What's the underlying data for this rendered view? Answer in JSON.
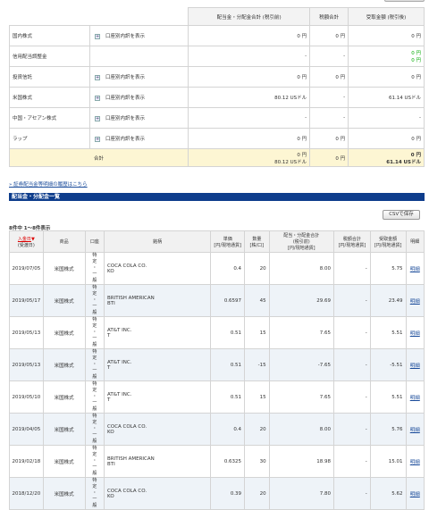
{
  "summary": {
    "headers": [
      "配当金・分配金合計 (税引前)",
      "税額合計",
      "受取金額 (税引後)"
    ],
    "rows": [
      {
        "label": "国内株式",
        "toggle": "口座別内訳を表示",
        "gross": [
          "0 円"
        ],
        "tax": [
          "0 円"
        ],
        "net": [
          "0 円"
        ]
      },
      {
        "label": "信用配当調整金",
        "toggle": "",
        "gross": [
          "-"
        ],
        "tax": [
          "-"
        ],
        "net": [
          "0 円",
          "0 円"
        ]
      },
      {
        "label": "投資信託",
        "toggle": "口座別内訳を表示",
        "gross": [
          "0 円"
        ],
        "tax": [
          "0 円"
        ],
        "net": [
          "0 円"
        ]
      },
      {
        "label": "米国株式",
        "toggle": "口座別内訳を表示",
        "gross": [
          "80.12 USドル"
        ],
        "tax": [
          "-"
        ],
        "net": [
          "61.14 USドル"
        ]
      },
      {
        "label": "中国・アセアン株式",
        "toggle": "口座別内訳を表示",
        "gross": [
          "-"
        ],
        "tax": [
          "-"
        ],
        "net": [
          "-"
        ]
      },
      {
        "label": "ラップ",
        "toggle": "口座別内訳を表示",
        "gross": [
          "0 円"
        ],
        "tax": [
          "0 円"
        ],
        "net": [
          "0 円"
        ]
      }
    ],
    "total": {
      "label": "合計",
      "gross": [
        "0 円",
        "80.12 USドル"
      ],
      "tax": [
        "0 円"
      ],
      "net": [
        "0 円",
        "61.14 USドル"
      ]
    }
  },
  "link_text": "» 証券配当金等明細の履歴はこちら",
  "section_title": "配当金・分配金一覧",
  "csv_button": "CSVで保存",
  "count_text": "8件中 1～8件表示",
  "table": {
    "headers": {
      "date": "入金日",
      "date_sub": "(受渡日)",
      "product": "商品",
      "account": "口座",
      "name": "銘柄",
      "unit": "単価",
      "unit_sub": "[円/現地通貨]",
      "qty": "数量",
      "qty_sub": "[株/口]",
      "gross": "配当・分配金合計",
      "gross_sub": "(税引前)",
      "gross_sub2": "[円/現地通貨]",
      "tax": "税額合計",
      "tax_sub": "[円/現地通貨]",
      "net": "受取金額",
      "net_sub": "[円/現地通貨]",
      "detail": "明細"
    },
    "rows": [
      {
        "date": "2019/07/05",
        "product": "米国株式",
        "account": [
          "特",
          "定",
          "・",
          "一",
          "般"
        ],
        "name1": "COCA COLA CO.",
        "name2": "KO",
        "unit": "0.4",
        "qty": "20",
        "gross": "8.00",
        "tax": "-",
        "net": "5.75",
        "detail": "明細"
      },
      {
        "date": "2019/05/17",
        "product": "米国株式",
        "account": [
          "特",
          "定",
          "・",
          "一",
          "般"
        ],
        "name1": "BRITISH AMERICAN",
        "name2": "BTI",
        "unit": "0.6597",
        "qty": "45",
        "gross": "29.69",
        "tax": "-",
        "net": "23.49",
        "detail": "明細"
      },
      {
        "date": "2019/05/13",
        "product": "米国株式",
        "account": [
          "特",
          "定",
          "・",
          "一",
          "般"
        ],
        "name1": "AT&T INC.",
        "name2": "T",
        "unit": "0.51",
        "qty": "15",
        "gross": "7.65",
        "tax": "-",
        "net": "5.51",
        "detail": "明細"
      },
      {
        "date": "2019/05/13",
        "product": "米国株式",
        "account": [
          "特",
          "定",
          "・",
          "一",
          "般"
        ],
        "name1": "AT&T INC.",
        "name2": "T",
        "unit": "0.51",
        "qty": "-15",
        "gross": "-7.65",
        "tax": "-",
        "net": "-5.51",
        "detail": "明細"
      },
      {
        "date": "2019/05/10",
        "product": "米国株式",
        "account": [
          "特",
          "定",
          "・",
          "一",
          "般"
        ],
        "name1": "AT&T INC.",
        "name2": "T",
        "unit": "0.51",
        "qty": "15",
        "gross": "7.65",
        "tax": "-",
        "net": "5.51",
        "detail": "明細"
      },
      {
        "date": "2019/04/05",
        "product": "米国株式",
        "account": [
          "特",
          "定",
          "・",
          "一",
          "般"
        ],
        "name1": "COCA COLA CO.",
        "name2": "KO",
        "unit": "0.4",
        "qty": "20",
        "gross": "8.00",
        "tax": "-",
        "net": "5.76",
        "detail": "明細"
      },
      {
        "date": "2019/02/18",
        "product": "米国株式",
        "account": [
          "特",
          "定",
          "・",
          "一",
          "般"
        ],
        "name1": "BRITISH AMERICAN",
        "name2": "BTI",
        "unit": "0.6325",
        "qty": "30",
        "gross": "18.98",
        "tax": "-",
        "net": "15.01",
        "detail": "明細"
      },
      {
        "date": "2018/12/20",
        "product": "米国株式",
        "account": [
          "特",
          "定",
          "・",
          "一",
          "般"
        ],
        "name1": "COCA COLA CO.",
        "name2": "KO",
        "unit": "0.39",
        "gross": "7.80",
        "qty": "20",
        "tax": "-",
        "net": "5.62",
        "detail": "明細"
      }
    ]
  },
  "colors": {
    "section_bar": "#0e3d8c",
    "total_row": "#fdf6d3",
    "alt_row": "#eef3f8",
    "link": "#1a4b9a"
  }
}
